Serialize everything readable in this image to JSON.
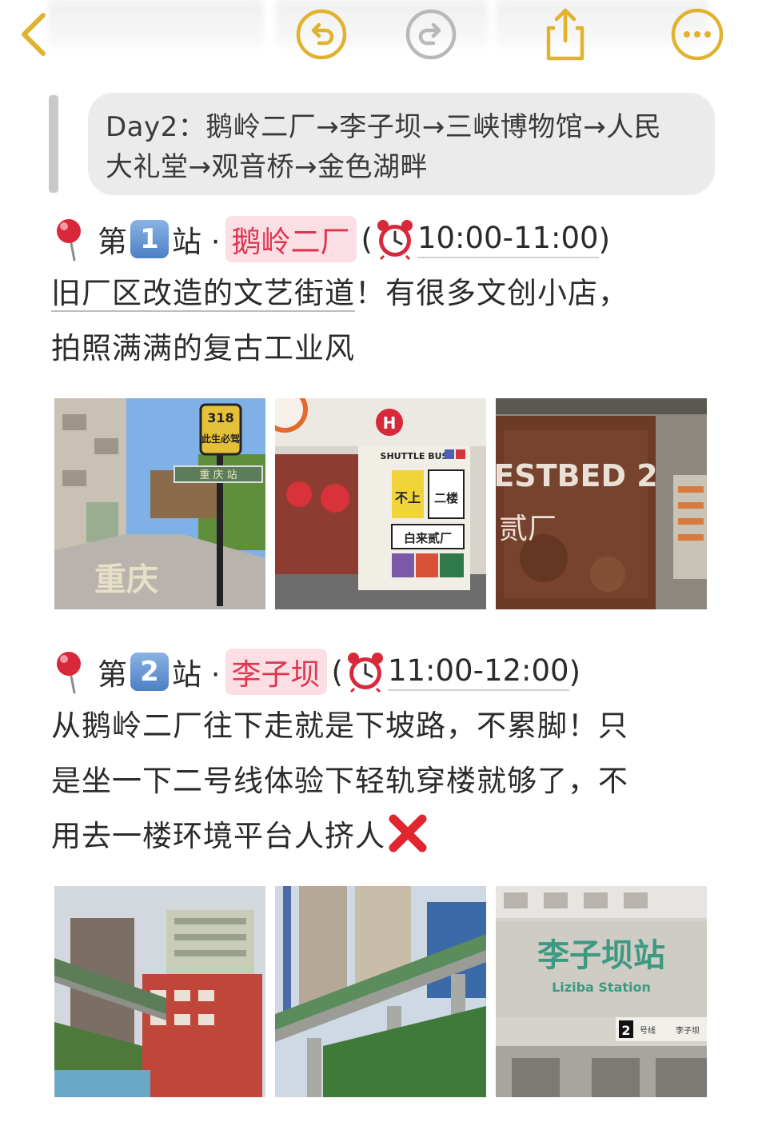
{
  "toolbar": {
    "back_icon": "chevron-left-icon",
    "undo_icon": "undo-icon",
    "redo_icon": "redo-icon",
    "share_icon": "share-icon",
    "more_icon": "more-icon",
    "accent_color": "#e0b22e",
    "disabled_color": "#b8b8b8"
  },
  "summary": {
    "line1": "Day2：鹅岭二厂→李子坝→三峡博物馆→人民",
    "line2": "大礼堂→观音桥→金色湖畔"
  },
  "stations": [
    {
      "prefix": "第",
      "number": "1",
      "suffix": "站 ·",
      "name": "鹅岭二厂",
      "open_paren": "(",
      "time": "10:00-11:00",
      "close_paren": ")",
      "desc_line1_underlined": "旧厂区改造的文艺街道",
      "desc_line1_rest": "！有很多文创小店，",
      "desc_line2": "拍照满满的复古工业风",
      "photos": [
        {
          "text_top": "318",
          "text_mid": "此生必驾",
          "text_sign": "重 庆 站",
          "text_road": "重庆"
        },
        {
          "text_h": "H",
          "text_bus": "SHUTTLE BUS",
          "text_a": "不上",
          "text_b": "二楼",
          "text_c": "白来贰厂"
        },
        {
          "text_sign": "ESTBED 2",
          "text_sub": "贰厂"
        }
      ]
    },
    {
      "prefix": "第",
      "number": "2",
      "suffix": "站 ·",
      "name": "李子坝",
      "open_paren": "(",
      "time": "11:00-12:00",
      "close_paren": ")",
      "desc_line1": "从鹅岭二厂往下走就是下坡路，不累脚！只",
      "desc_line2": "是坐一下二号线体验下轻轨穿楼就够了，不",
      "desc_line3": "用去一楼环境平台人挤人",
      "desc_icon": "cross-mark-icon",
      "photos": [
        {},
        {},
        {
          "text_sign": "李子坝站",
          "text_en": "Liziba Station",
          "text_line": "2",
          "text_line_label": "号线",
          "text_station_small": "李子坝"
        }
      ]
    }
  ]
}
